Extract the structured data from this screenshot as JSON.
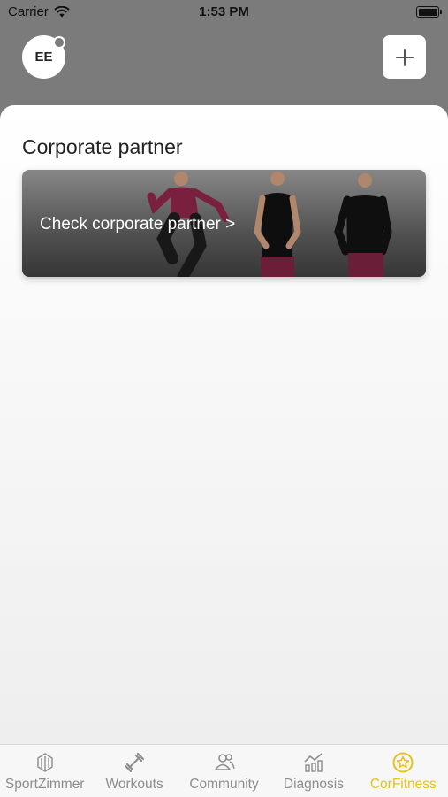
{
  "status_bar": {
    "carrier": "Carrier",
    "time": "1:53 PM"
  },
  "header": {
    "avatar_initials": "EE"
  },
  "main": {
    "section_title": "Corporate partner",
    "card_label": "Check corporate partner >"
  },
  "tab_bar": {
    "tabs": [
      {
        "label": "SportZimmer",
        "icon": "sportzimmer-icon"
      },
      {
        "label": "Workouts",
        "icon": "dumbbell-icon"
      },
      {
        "label": "Community",
        "icon": "community-icon"
      },
      {
        "label": "Diagnosis",
        "icon": "chart-icon"
      },
      {
        "label": "CorFitness",
        "icon": "star-circle-icon"
      }
    ],
    "active_color": "#e8c215",
    "inactive_color": "#8d8d8d"
  }
}
